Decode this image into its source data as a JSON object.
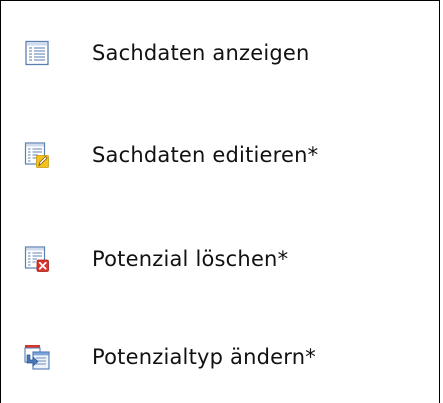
{
  "context_menu": {
    "items": [
      {
        "label": "Sachdaten anzeigen",
        "icon": "table-icon"
      },
      {
        "label": "Sachdaten editieren*",
        "icon": "table-edit-icon"
      },
      {
        "label": "Potenzial löschen*",
        "icon": "table-delete-icon"
      },
      {
        "label": "Potenzialtyp ändern*",
        "icon": "change-type-icon"
      }
    ]
  },
  "colors": {
    "border": "#000000",
    "text": "#111111",
    "icon_blue": "#4a78b8",
    "icon_yellow": "#f2c21b",
    "icon_red": "#d9342b"
  }
}
